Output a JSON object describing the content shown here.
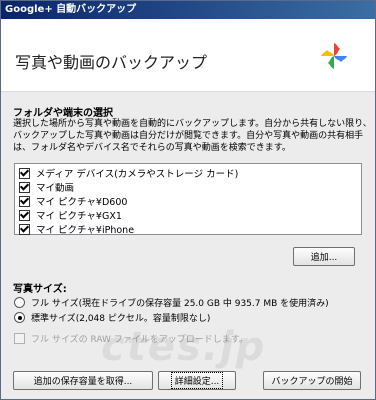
{
  "window": {
    "title": "Google+ 自動バックアップ"
  },
  "header": {
    "title": "写真や動画のバックアップ"
  },
  "folders": {
    "heading": "フォルダや端末の選択",
    "description_lines": [
      "選択した場所から写真や動画を自動的にバックアップします。自分から共有しない限り、",
      "バックアップした写真や動画は自分だけが閲覧できます。自分や写真や動画の共有相手",
      "は、フォルダ名やデバイス名でそれらの写真や動画を検索できます。"
    ],
    "items": [
      {
        "label": "メディア デバイス(カメラやストレージ カード)",
        "checked": true
      },
      {
        "label": "マイ動画",
        "checked": true
      },
      {
        "label": "マイ ピクチャ¥D600",
        "checked": true
      },
      {
        "label": "マイ ピクチャ¥GX1",
        "checked": true
      },
      {
        "label": "マイ ピクチャ¥iPhone",
        "checked": true
      }
    ],
    "add_button": "追加..."
  },
  "photo_size": {
    "heading": "写真サイズ:",
    "options": [
      {
        "label": "フル サイズ(現在ドライブの保存容量 25.0 GB 中 935.7 MB を使用済み)",
        "selected": false
      },
      {
        "label": "標準サイズ(2,048 ピクセル。容量制限なし)",
        "selected": true
      }
    ],
    "raw_upload_label": "フル サイズの RAW ファイルをアップロードします。"
  },
  "footer": {
    "buy_storage_button": "追加の保存容量を取得...",
    "advanced_button": "詳細設定...",
    "start_backup_button": "バックアップの開始"
  },
  "watermark": "ctes.jp"
}
